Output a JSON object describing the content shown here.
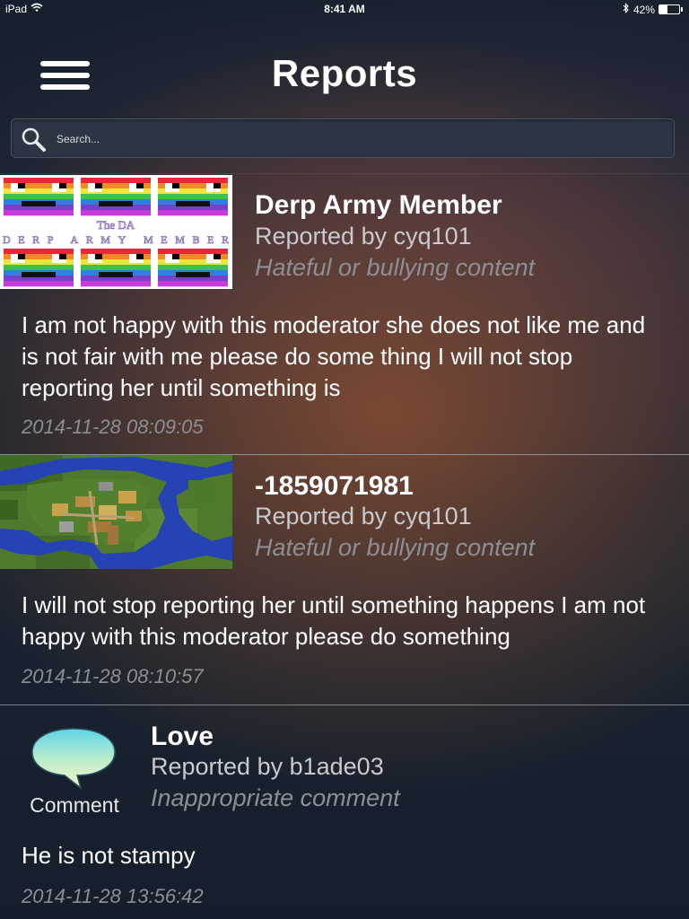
{
  "status_bar": {
    "device": "iPad",
    "time": "8:41 AM",
    "battery_percent": "42%",
    "battery_level": 0.42,
    "icons": [
      "wifi-icon",
      "bluetooth-icon",
      "battery-icon"
    ]
  },
  "header": {
    "title": "Reports",
    "menu_icon": "hamburger-menu-icon"
  },
  "search": {
    "placeholder": "Search...",
    "value": "",
    "icon": "search-icon"
  },
  "reports": [
    {
      "title": "Derp Army Member",
      "reported_by": "Reported by cyq101",
      "reason": "Hateful or bullying content",
      "body": "I am not happy with this moderator she does not like me and is not fair with me please do some thing I will not stop reporting her until something is",
      "date": "2014-11-28 08:09:05",
      "thumbnail": {
        "kind": "image",
        "caption_line1": "The DA",
        "caption_line2": "DERP ARMY MEMBER"
      }
    },
    {
      "title": "-1859071981",
      "reported_by": "Reported by cyq101",
      "reason": "Hateful or bullying content",
      "body": "I will not stop reporting her until something happens I am not happy with this moderator please do something",
      "date": "2014-11-28 08:10:57",
      "thumbnail": {
        "kind": "image"
      }
    },
    {
      "title": "Love",
      "reported_by": "Reported by b1ade03",
      "reason": "Inappropriate comment",
      "body": "He is not stampy",
      "date": "2014-11-28 13:56:42",
      "thumbnail": {
        "kind": "comment",
        "label": "Comment",
        "icon": "speech-bubble-icon"
      }
    }
  ],
  "colors": {
    "background": "#1a2430",
    "accent_warm": "#8a4e32",
    "text_primary": "#ffffff",
    "text_secondary": "#c9c9ce",
    "text_muted": "#8c8f95"
  }
}
